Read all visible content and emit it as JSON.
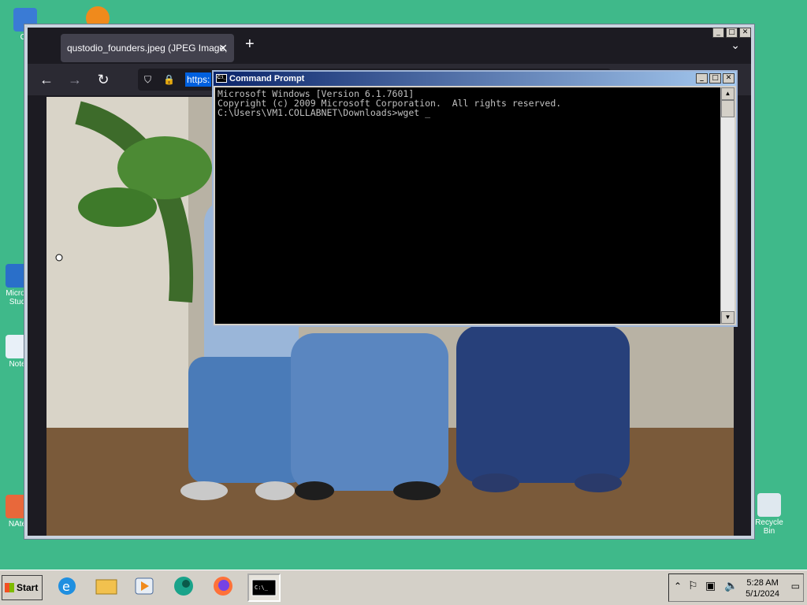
{
  "desktop": {
    "icons": [
      {
        "label": "Co",
        "icon": "computer-icon"
      },
      {
        "label": "Micros Stud",
        "icon": "shortcut-icon"
      },
      {
        "label": "Note",
        "icon": "notepad-icon"
      },
      {
        "label": "NAte",
        "icon": "app-icon"
      },
      {
        "label": "Recycle Bin",
        "icon": "recycle-bin-icon"
      }
    ]
  },
  "browser": {
    "tab_title": "qustodio_founders.jpeg (JPEG Image,",
    "url_text": "https:",
    "new_tab": "+",
    "list_all_tabs": "⌄"
  },
  "cmd": {
    "title": "Command Prompt",
    "icon_text": "C:\\_",
    "lines": [
      "Microsoft Windows [Version 6.1.7601]",
      "Copyright (c) 2009 Microsoft Corporation.  All rights reserved.",
      "",
      "C:\\Users\\VM1.COLLABNET\\Downloads>wget _"
    ]
  },
  "taskbar": {
    "start_label": "Start",
    "items": [
      "ie-icon",
      "explorer-icon",
      "media-player-icon",
      "app-icon",
      "firefox-icon",
      "cmd-icon"
    ],
    "time": "5:28 AM",
    "date": "5/1/2024"
  }
}
